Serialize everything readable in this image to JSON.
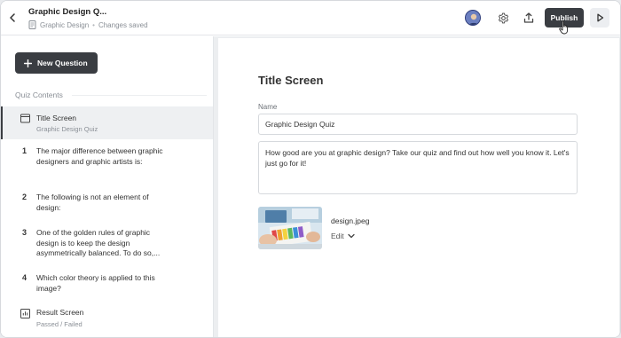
{
  "header": {
    "title": "Graphic Design Q...",
    "category": "Graphic Design",
    "separator": "•",
    "save_status": "Changes saved",
    "publish_label": "Publish"
  },
  "sidebar": {
    "new_question_label": "New Question",
    "section_label": "Quiz Contents",
    "items": [
      {
        "type": "title",
        "label": "Title Screen",
        "sub": "Graphic Design Quiz",
        "active": true
      },
      {
        "type": "question",
        "num": "1",
        "label": "The major difference between graphic designers and graphic artists is:"
      },
      {
        "type": "question",
        "num": "2",
        "label": "The following is not an element of design:"
      },
      {
        "type": "question",
        "num": "3",
        "label": "One of the golden rules of graphic design is to keep the design asymmetrically balanced. To do so,..."
      },
      {
        "type": "question",
        "num": "4",
        "label": "Which color theory is applied to this image?"
      },
      {
        "type": "result",
        "label": "Result Screen",
        "sub": "Passed / Failed"
      }
    ]
  },
  "main": {
    "heading": "Title Screen",
    "name_label": "Name",
    "name_value": "Graphic Design Quiz",
    "description": "How good are you at graphic design? Take our quiz and find out how well you know it. Let's just go for it!",
    "file_name": "design.jpeg",
    "edit_label": "Edit"
  },
  "icons": {
    "back": "chevron-left-icon",
    "settings": "gear-icon",
    "share": "upload-icon",
    "preview": "play-icon"
  },
  "colors": {
    "primary_button": "#3a3d42",
    "active_item_bg": "#eef0f2",
    "canvas_bg": "#eceef0"
  }
}
